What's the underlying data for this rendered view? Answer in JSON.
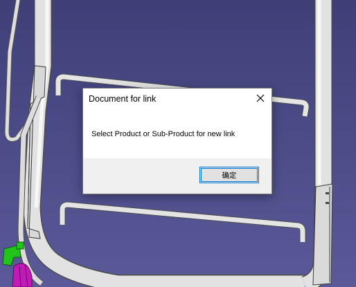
{
  "dialog": {
    "title": "Document for link",
    "message": "Select Product or Sub-Product for new link",
    "ok_label": "确定"
  },
  "colors": {
    "viewport_background": "#4a4a87",
    "tube": "#e6e6e6",
    "tube_edge": "#505050",
    "part_green": "#22c41c",
    "part_magenta": "#c21ab8"
  },
  "icons": {
    "close": "close-icon"
  }
}
